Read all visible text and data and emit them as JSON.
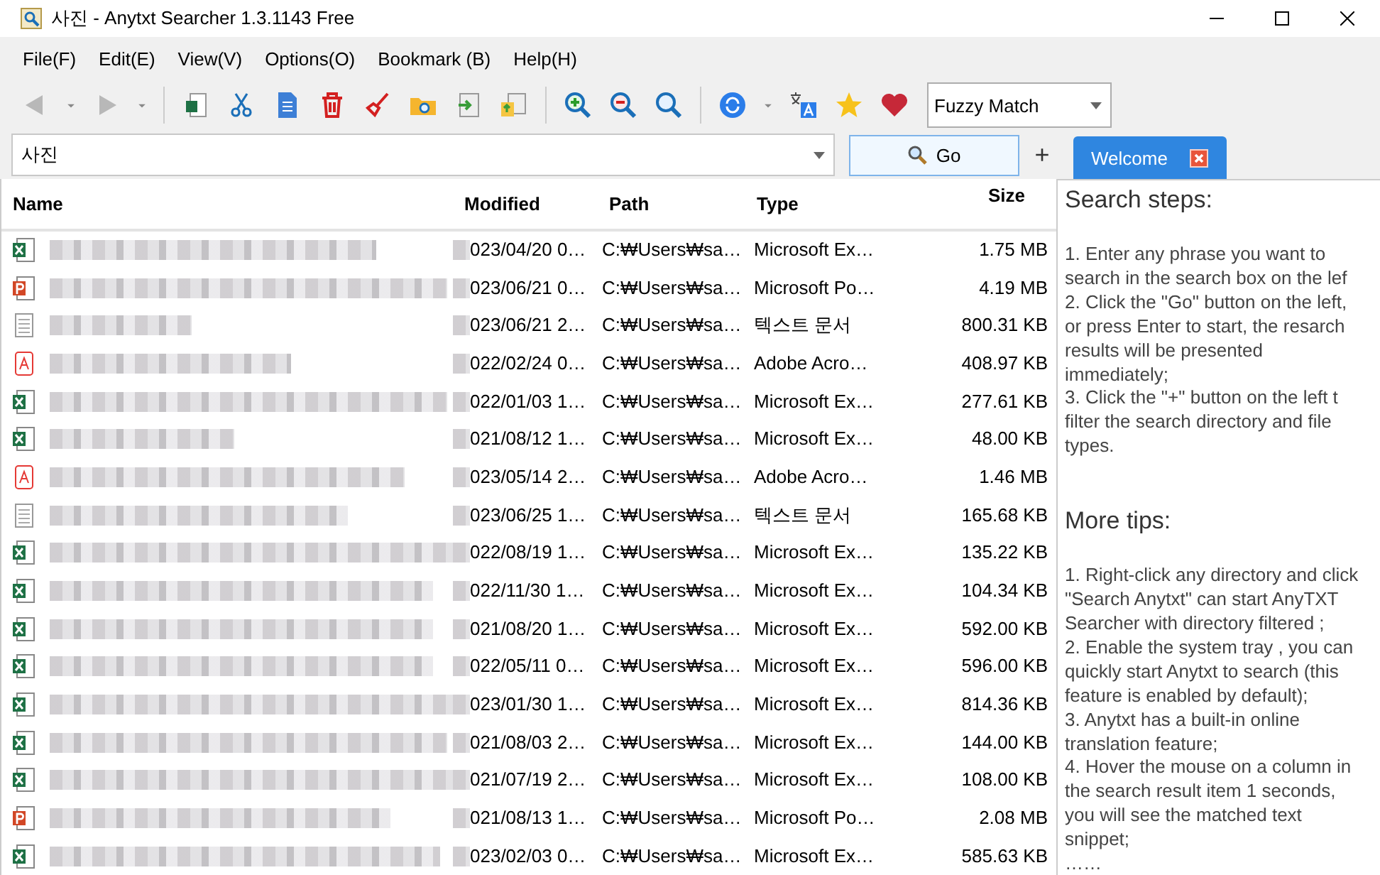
{
  "window": {
    "title": "사진 - Anytxt Searcher 1.3.1143 Free"
  },
  "menu": [
    "File(F)",
    "Edit(E)",
    "View(V)",
    "Options(O)",
    "Bookmark (B)",
    "Help(H)"
  ],
  "match_mode": "Fuzzy Match",
  "search": {
    "value": "사진",
    "go_label": "Go",
    "add_label": "+"
  },
  "tabs": [
    {
      "label": "Welcome",
      "selected": true
    }
  ],
  "table": {
    "columns": [
      "Name",
      "Modified",
      "Path",
      "Type",
      "Size"
    ],
    "rows": [
      {
        "kind": "excel",
        "modified": "023/04/20 0…",
        "path": "C:₩Users₩sa…",
        "type": "Microsoft Ex…",
        "size": "1.75 MB"
      },
      {
        "kind": "powerpoint",
        "modified": "023/06/21 0…",
        "path": "C:₩Users₩sa…",
        "type": "Microsoft Po…",
        "size": "4.19 MB"
      },
      {
        "kind": "text",
        "modified": "023/06/21 2…",
        "path": "C:₩Users₩sa…",
        "type": "텍스트 문서",
        "size": "800.31 KB"
      },
      {
        "kind": "pdf",
        "modified": "022/02/24 0…",
        "path": "C:₩Users₩sa…",
        "type": "Adobe Acro…",
        "size": "408.97 KB"
      },
      {
        "kind": "excel",
        "modified": "022/01/03 1…",
        "path": "C:₩Users₩sa…",
        "type": "Microsoft Ex…",
        "size": "277.61 KB"
      },
      {
        "kind": "excel",
        "modified": "021/08/12 1…",
        "path": "C:₩Users₩sa…",
        "type": "Microsoft Ex…",
        "size": "48.00 KB"
      },
      {
        "kind": "pdf",
        "modified": "023/05/14 2…",
        "path": "C:₩Users₩sa…",
        "type": "Adobe Acro…",
        "size": "1.46 MB"
      },
      {
        "kind": "text",
        "modified": "023/06/25 1…",
        "path": "C:₩Users₩sa…",
        "type": "텍스트 문서",
        "size": "165.68 KB"
      },
      {
        "kind": "excel",
        "modified": "022/08/19 1…",
        "path": "C:₩Users₩sa…",
        "type": "Microsoft Ex…",
        "size": "135.22 KB"
      },
      {
        "kind": "excel",
        "modified": "022/11/30 1…",
        "path": "C:₩Users₩sa…",
        "type": "Microsoft Ex…",
        "size": "104.34 KB"
      },
      {
        "kind": "excel",
        "modified": "021/08/20 1…",
        "path": "C:₩Users₩sa…",
        "type": "Microsoft Ex…",
        "size": "592.00 KB"
      },
      {
        "kind": "excel",
        "modified": "022/05/11 0…",
        "path": "C:₩Users₩sa…",
        "type": "Microsoft Ex…",
        "size": "596.00 KB"
      },
      {
        "kind": "excel",
        "modified": "023/01/30 1…",
        "path": "C:₩Users₩sa…",
        "type": "Microsoft Ex…",
        "size": "814.36 KB"
      },
      {
        "kind": "excel",
        "modified": "021/08/03 2…",
        "path": "C:₩Users₩sa…",
        "type": "Microsoft Ex…",
        "size": "144.00 KB"
      },
      {
        "kind": "excel",
        "modified": "021/07/19 2…",
        "path": "C:₩Users₩sa…",
        "type": "Microsoft Ex…",
        "size": "108.00 KB"
      },
      {
        "kind": "powerpoint",
        "modified": "021/08/13 1…",
        "path": "C:₩Users₩sa…",
        "type": "Microsoft Po…",
        "size": "2.08 MB"
      },
      {
        "kind": "excel",
        "modified": "023/02/03 0…",
        "path": "C:₩Users₩sa…",
        "type": "Microsoft Ex…",
        "size": "585.63 KB"
      }
    ]
  },
  "welcome": {
    "sections": [
      {
        "heading": "Search steps:",
        "lines": [
          "1. Enter any phrase you want to",
          "search in the search box on the lef",
          "2. Click the \"Go\" button on the left,",
          "or press Enter to start, the resarch",
          "results will be presented",
          "immediately;",
          "3. Click the \"+\" button on the left t",
          "filter the search directory and file",
          "types."
        ]
      },
      {
        "heading": "More tips:",
        "lines": [
          "1. Right-click any directory and click",
          "\"Search Anytxt\" can start AnyTXT",
          "Searcher with directory filtered ;",
          "2. Enable the system tray , you can",
          "quickly start Anytxt to search (this",
          "feature is enabled by default);",
          "3. Anytxt has a built-in online",
          "translation feature;",
          "4. Hover the mouse on a column in",
          "the search result item 1 seconds,",
          "you will see the matched text",
          "snippet;",
          "……"
        ]
      }
    ]
  }
}
